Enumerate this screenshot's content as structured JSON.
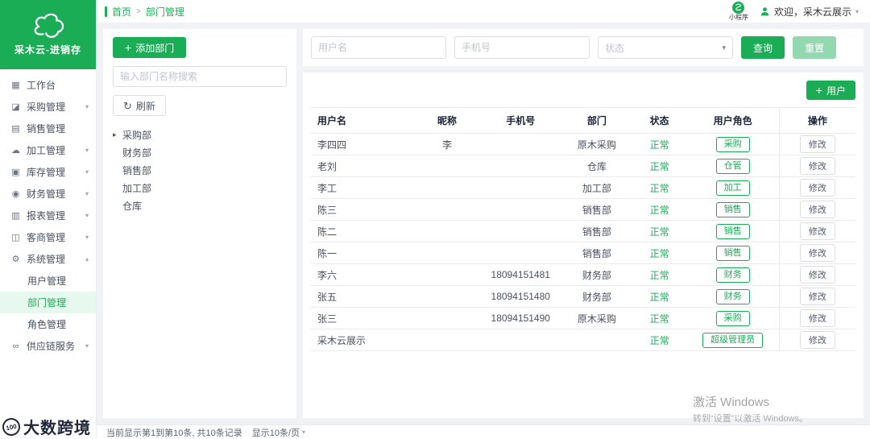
{
  "colors": {
    "green": "#1bad56",
    "light_green": "#93d9b0",
    "active_bg": "#e7f9ee"
  },
  "icons": {
    "plus": "+",
    "chevron_down": "▾",
    "chevron_up": "▴",
    "caret_right": "▸",
    "refresh": "↻",
    "dropdown": "▾"
  },
  "brand": {
    "name": "采木云-进销存"
  },
  "topbar": {
    "breadcrumb": {
      "home": "首页",
      "separator": ">",
      "current": "部门管理"
    },
    "mini_program_label": "小程序",
    "welcome": "欢迎，采木云展示"
  },
  "sidebar": {
    "items": [
      {
        "key": "workbench",
        "label": "工作台",
        "icon": "workbench-icon",
        "glyph": "▦"
      },
      {
        "key": "purchase",
        "label": "采购管理",
        "icon": "purchase-icon",
        "glyph": "◪",
        "chevron": "down"
      },
      {
        "key": "sales",
        "label": "销售管理",
        "icon": "sales-icon",
        "glyph": "▤"
      },
      {
        "key": "processing",
        "label": "加工管理",
        "icon": "processing-icon",
        "glyph": "☁",
        "chevron": "down"
      },
      {
        "key": "inventory",
        "label": "库存管理",
        "icon": "inventory-icon",
        "glyph": "▣",
        "chevron": "down"
      },
      {
        "key": "finance",
        "label": "财务管理",
        "icon": "finance-icon",
        "glyph": "◉",
        "chevron": "down"
      },
      {
        "key": "report",
        "label": "报表管理",
        "icon": "report-icon",
        "glyph": "▥",
        "chevron": "down"
      },
      {
        "key": "customer",
        "label": "客商管理",
        "icon": "customer-icon",
        "glyph": "◫",
        "chevron": "down"
      },
      {
        "key": "system",
        "label": "系统管理",
        "icon": "system-icon",
        "glyph": "⚙",
        "chevron": "up",
        "children": [
          {
            "key": "user-mgmt",
            "label": "用户管理",
            "active": false
          },
          {
            "key": "dept-mgmt",
            "label": "部门管理",
            "active": true
          },
          {
            "key": "role-mgmt",
            "label": "角色管理",
            "active": false
          }
        ]
      },
      {
        "key": "supply",
        "label": "供应链服务",
        "icon": "supply-icon",
        "glyph": "∞",
        "chevron": "down"
      }
    ]
  },
  "dept_panel": {
    "add_button": "添加部门",
    "search_placeholder": "输入部门名称搜索",
    "refresh_button": "刷新",
    "tree": [
      {
        "label": "采购部",
        "expandable": true
      },
      {
        "label": "财务部",
        "expandable": false
      },
      {
        "label": "销售部",
        "expandable": false
      },
      {
        "label": "加工部",
        "expandable": false
      },
      {
        "label": "仓库",
        "expandable": false
      }
    ]
  },
  "filters": {
    "username_placeholder": "用户名",
    "phone_placeholder": "手机号",
    "status_placeholder": "状态",
    "search_button": "查询",
    "reset_button": "重置"
  },
  "user_table": {
    "add_button": "用户",
    "headers": [
      "用户名",
      "昵称",
      "手机号",
      "部门",
      "状态",
      "用户角色",
      "操作"
    ],
    "rows": [
      {
        "username": "李四四",
        "nickname": "李",
        "phone": "",
        "dept": "原木采购",
        "status": "正常",
        "role": "采购",
        "action": "修改"
      },
      {
        "username": "老刘",
        "nickname": "",
        "phone": "",
        "dept": "仓库",
        "status": "正常",
        "role": "仓管",
        "action": "修改"
      },
      {
        "username": "李工",
        "nickname": "",
        "phone": "",
        "dept": "加工部",
        "status": "正常",
        "role": "加工",
        "action": "修改"
      },
      {
        "username": "陈三",
        "nickname": "",
        "phone": "",
        "dept": "销售部",
        "status": "正常",
        "role": "销售",
        "action": "修改"
      },
      {
        "username": "陈二",
        "nickname": "",
        "phone": "",
        "dept": "销售部",
        "status": "正常",
        "role": "销售",
        "action": "修改"
      },
      {
        "username": "陈一",
        "nickname": "",
        "phone": "",
        "dept": "销售部",
        "status": "正常",
        "role": "销售",
        "action": "修改"
      },
      {
        "username": "李六",
        "nickname": "",
        "phone": "18094151481",
        "dept": "财务部",
        "status": "正常",
        "role": "财务",
        "action": "修改"
      },
      {
        "username": "张五",
        "nickname": "",
        "phone": "18094151480",
        "dept": "财务部",
        "status": "正常",
        "role": "财务",
        "action": "修改"
      },
      {
        "username": "张三",
        "nickname": "",
        "phone": "18094151490",
        "dept": "原木采购",
        "status": "正常",
        "role": "采购",
        "action": "修改"
      },
      {
        "username": "采木云展示",
        "nickname": "",
        "phone": "",
        "dept": "",
        "status": "正常",
        "role": "超级管理员",
        "action": "修改"
      }
    ]
  },
  "footer": {
    "pagination_info": "当前显示第1到第10条, 共10条记录",
    "page_size": "显示10条/页"
  },
  "watermarks": {
    "brand_logo_text": "100",
    "brand_text": "大数跨境",
    "windows_line1": "激活 Windows",
    "windows_line2": "转到“设置”以激活 Windows。"
  }
}
